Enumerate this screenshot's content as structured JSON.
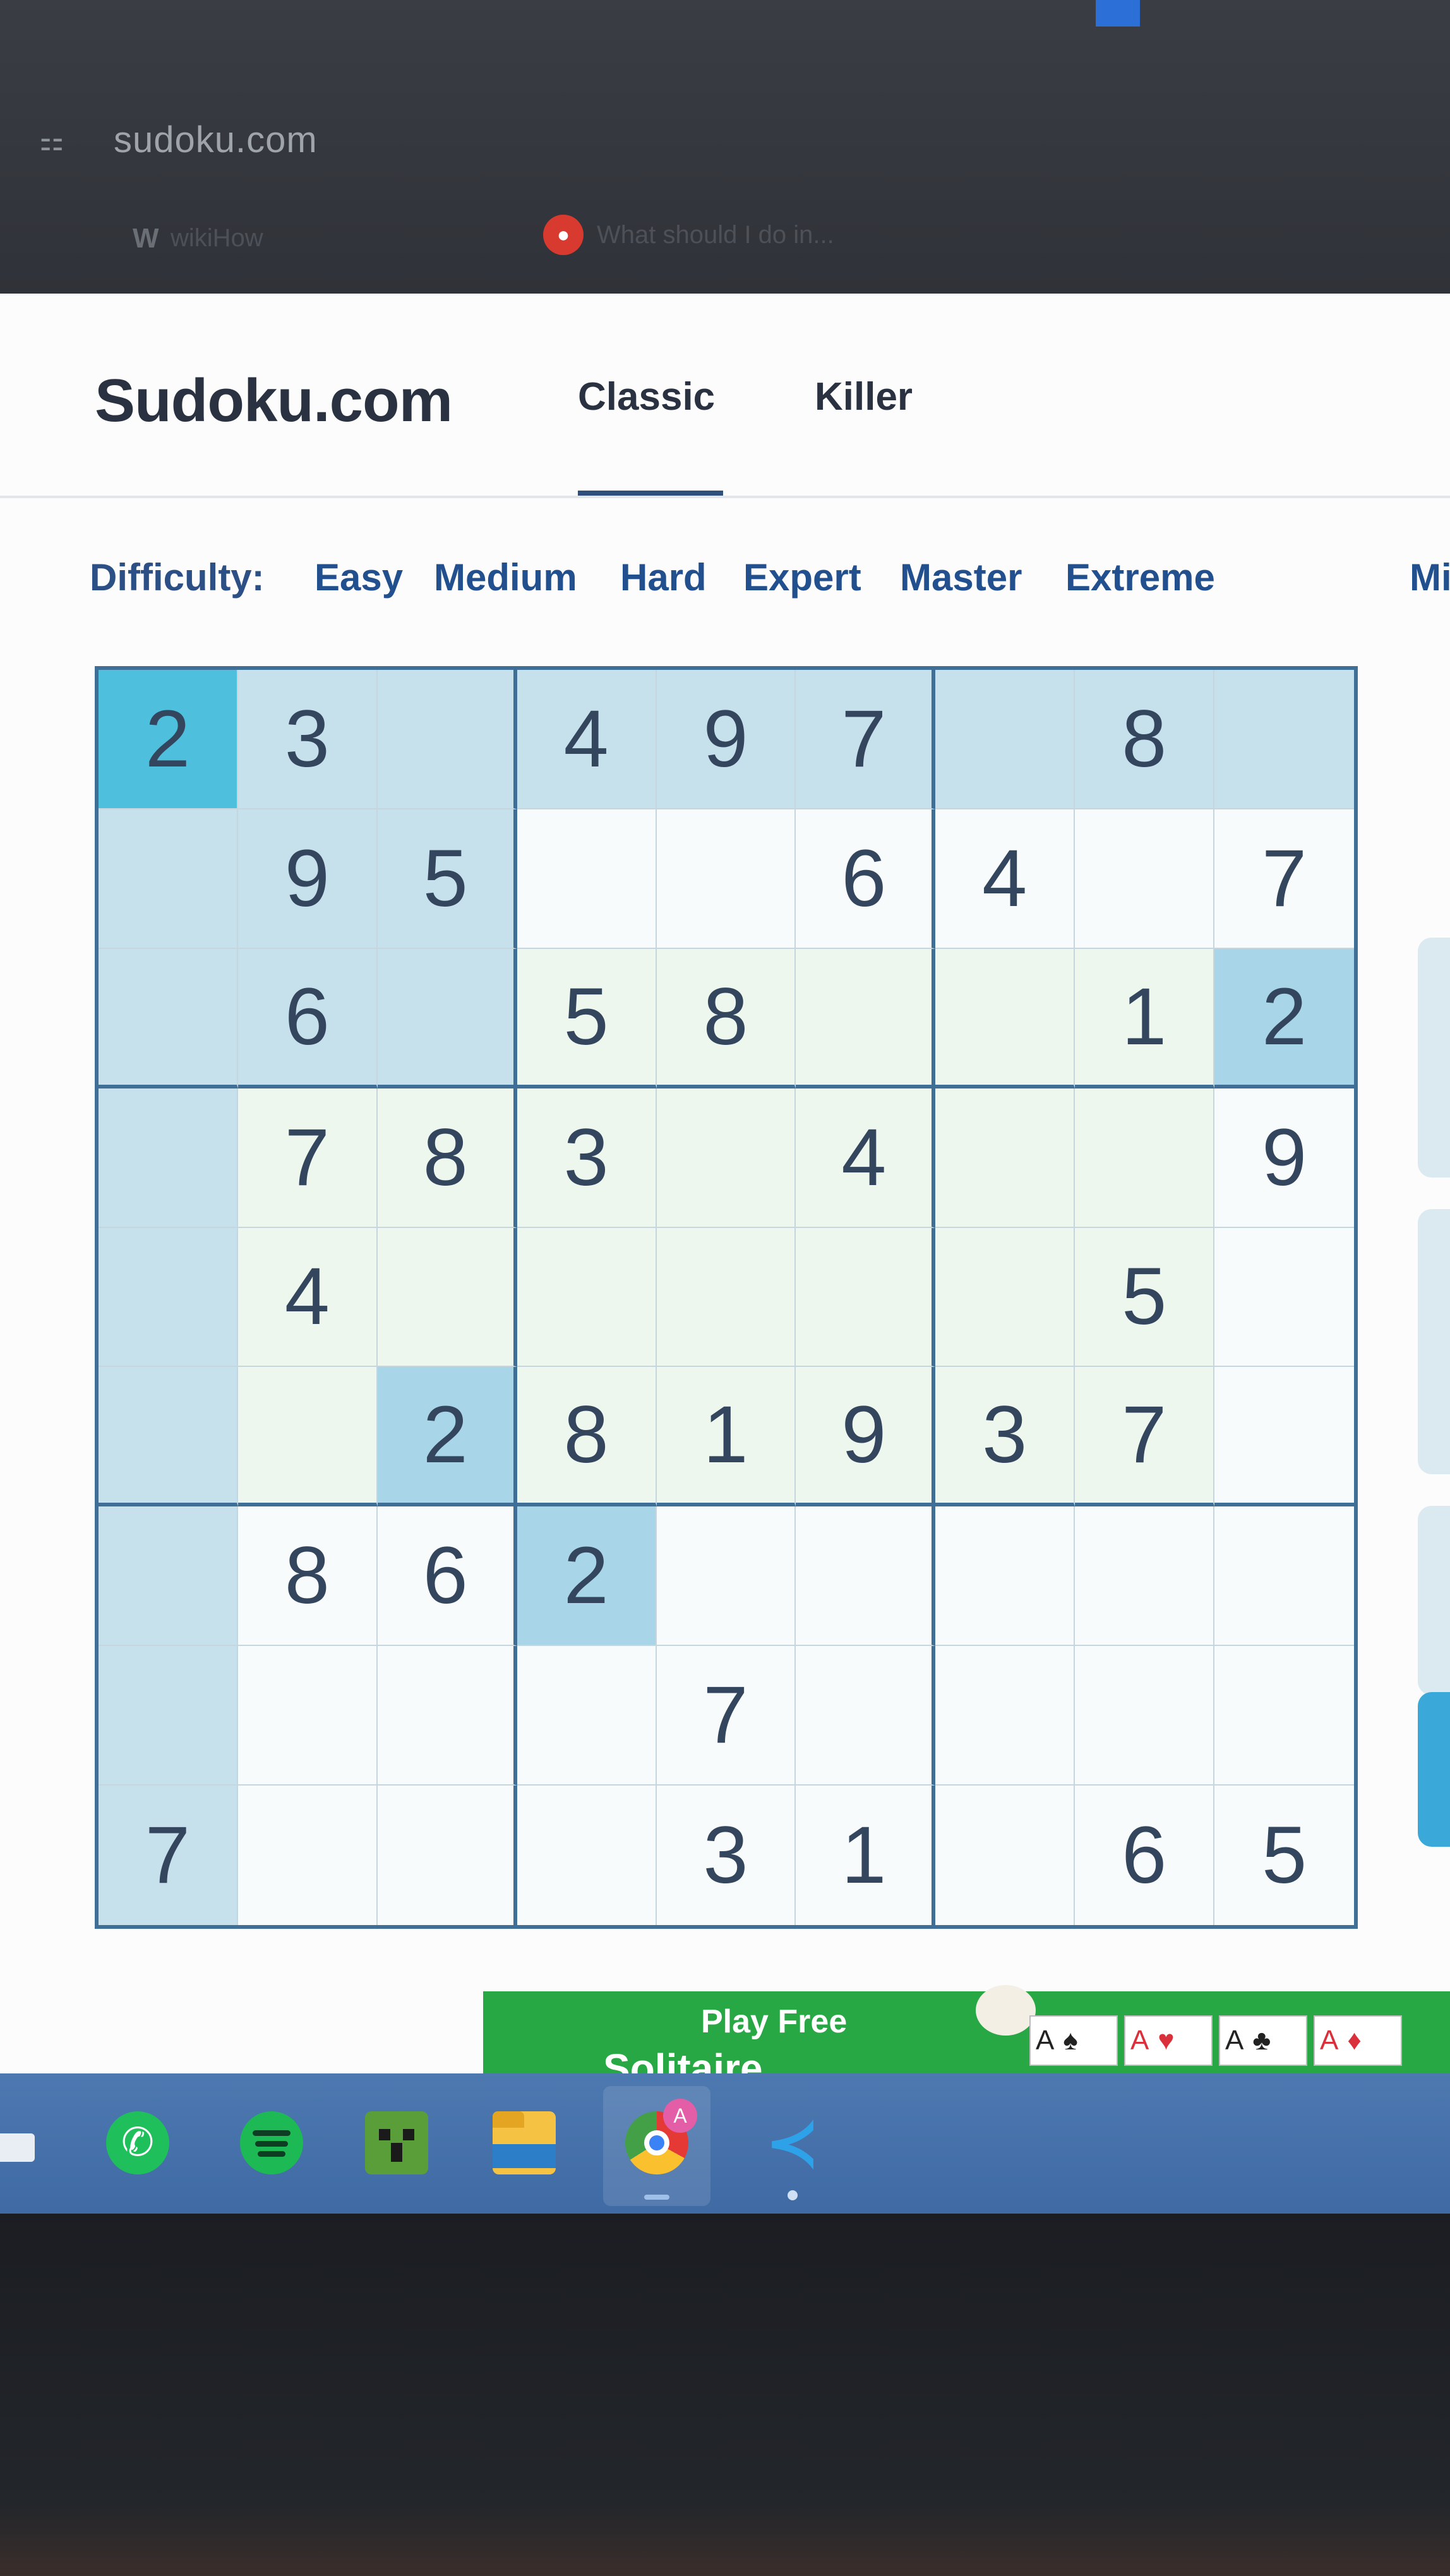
{
  "browser": {
    "address": "sudoku.com",
    "tabs": [
      {
        "icon": "wikihow-icon",
        "label": "wikiHow"
      },
      {
        "icon": "reddit-icon",
        "label": "What should I do in..."
      }
    ]
  },
  "header": {
    "logo": "Sudoku.com",
    "nav": [
      "Classic",
      "Killer"
    ],
    "active_nav": "Classic"
  },
  "difficulty": {
    "label": "Difficulty:",
    "levels": [
      "Easy",
      "Medium",
      "Hard",
      "Expert",
      "Master",
      "Extreme"
    ],
    "overflow_item": "Mi"
  },
  "board": {
    "cells": [
      [
        "2",
        "3",
        "",
        "4",
        "9",
        "7",
        "",
        "8",
        ""
      ],
      [
        "",
        "9",
        "5",
        "",
        "",
        "6",
        "4",
        "",
        "7"
      ],
      [
        "",
        "6",
        "",
        "5",
        "8",
        "",
        "",
        "1",
        "2"
      ],
      [
        "",
        "7",
        "8",
        "3",
        "",
        "4",
        "",
        "",
        "9"
      ],
      [
        "",
        "4",
        "",
        "",
        "",
        "",
        "",
        "5",
        ""
      ],
      [
        "",
        "",
        "2",
        "8",
        "1",
        "9",
        "3",
        "7",
        ""
      ],
      [
        "",
        "8",
        "6",
        "2",
        "",
        "",
        "",
        "",
        ""
      ],
      [
        "",
        "",
        "",
        "",
        "7",
        "",
        "",
        "",
        ""
      ],
      [
        "7",
        "",
        "",
        "",
        "3",
        "1",
        "",
        "6",
        "5"
      ]
    ],
    "selected": {
      "row": 0,
      "col": 0
    },
    "same_value_highlight": [
      [
        2,
        8
      ],
      [
        5,
        2
      ],
      [
        6,
        3
      ]
    ],
    "colors": {
      "selected": "#4fbfde",
      "related": "#c7e1ec",
      "same_value": "#a8d6e8",
      "digit": "#34465e",
      "border": "#3f6e96"
    }
  },
  "ad": {
    "headline": "Play Free",
    "subline": "Solitaire",
    "cards": [
      {
        "rank": "A",
        "suit": "♠",
        "color": "black"
      },
      {
        "rank": "A",
        "suit": "♥",
        "color": "red"
      },
      {
        "rank": "A",
        "suit": "♣",
        "color": "black"
      },
      {
        "rank": "A",
        "suit": "♦",
        "color": "red"
      }
    ]
  },
  "taskbar": {
    "apps": [
      "whatsapp-icon",
      "spotify-icon",
      "minecraft-icon",
      "file-explorer-icon",
      "chrome-icon",
      "vscode-icon"
    ],
    "active_app": "chrome-icon",
    "chrome_profile_badge": "A"
  }
}
